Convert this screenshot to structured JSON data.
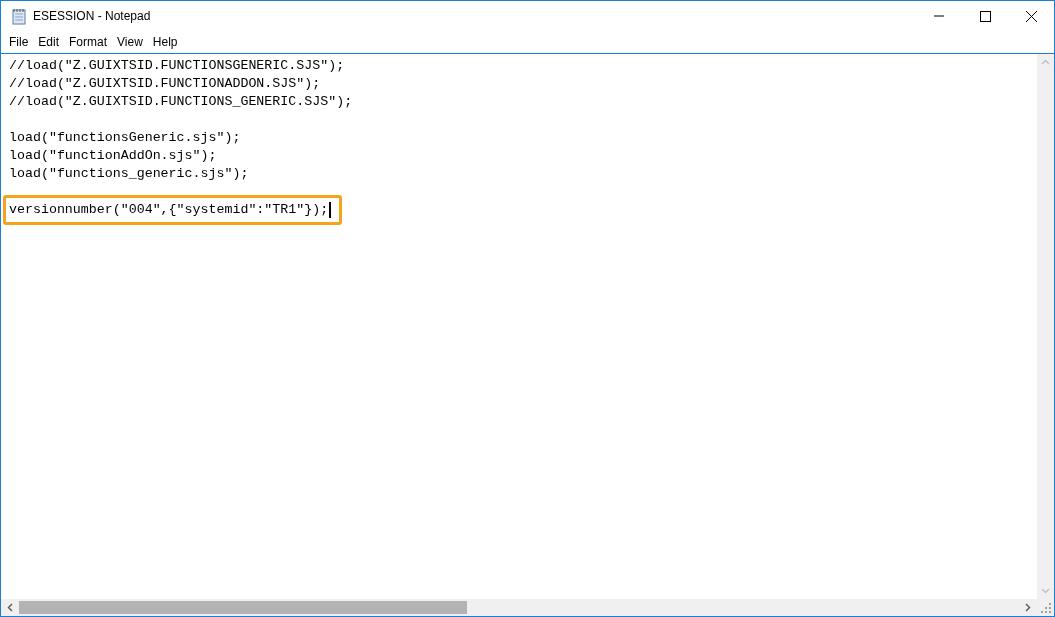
{
  "window": {
    "title": "ESESSION - Notepad"
  },
  "menu": [
    "File",
    "Edit",
    "Format",
    "View",
    "Help"
  ],
  "editor": {
    "lines": [
      {
        "kind": "code",
        "text": "//load(\"Z.GUIXTSID.FUNCTIONSGENERIC.SJS\");",
        "highlighted": false,
        "caret": false
      },
      {
        "kind": "code",
        "text": "//load(\"Z.GUIXTSID.FUNCTIONADDON.SJS\");",
        "highlighted": false,
        "caret": false
      },
      {
        "kind": "code",
        "text": "//load(\"Z.GUIXTSID.FUNCTIONS_GENERIC.SJS\");",
        "highlighted": false,
        "caret": false
      },
      {
        "kind": "blank"
      },
      {
        "kind": "code",
        "text": "load(\"functionsGeneric.sjs\");",
        "highlighted": false,
        "caret": false
      },
      {
        "kind": "code",
        "text": "load(\"functionAddOn.sjs\");",
        "highlighted": false,
        "caret": false
      },
      {
        "kind": "code",
        "text": "load(\"functions_generic.sjs\");",
        "highlighted": false,
        "caret": false
      },
      {
        "kind": "blank"
      },
      {
        "kind": "code",
        "text": "versionnumber(\"004\",{\"systemid\":\"TR1\"});",
        "highlighted": true,
        "caret": true
      }
    ]
  }
}
